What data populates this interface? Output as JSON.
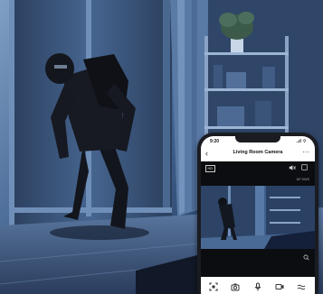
{
  "scene": {
    "description_free": true
  },
  "phone": {
    "status_time": "9:20",
    "status_signal": "..ıl ⌔",
    "title": "Living Room Camera",
    "hd_label": "HD",
    "speed_text": "187 KB/S"
  },
  "icons": [
    "back-icon",
    "more-icon",
    "mute-icon",
    "fullscreen-icon",
    "zoom-icon",
    "screenshot-icon",
    "camera-icon",
    "microphone-icon",
    "record-icon",
    "more-controls-icon"
  ],
  "colors": {
    "room_dark": "#1d2a3f",
    "room_blue": "#4a6fa3",
    "window_light": "#8fb2d6",
    "phone_body": "#1a1c22"
  }
}
